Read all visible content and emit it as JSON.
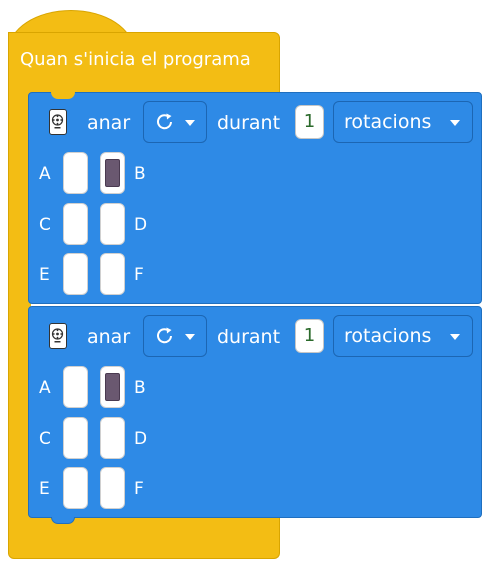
{
  "event_block": {
    "title": "Quan s'inicia el programa",
    "color": "#f3bd14"
  },
  "motor_blocks": [
    {
      "icon": "remote-control-icon",
      "action_label": "anar",
      "direction_icon": "clockwise-rotate-icon",
      "duration_label": "durant",
      "amount": "1",
      "unit": "rotacions",
      "ports": [
        {
          "letter": "A",
          "selected": false
        },
        {
          "letter": "B",
          "selected": true
        },
        {
          "letter": "C",
          "selected": false
        },
        {
          "letter": "D",
          "selected": false
        },
        {
          "letter": "E",
          "selected": false
        },
        {
          "letter": "F",
          "selected": false
        }
      ]
    },
    {
      "icon": "remote-control-icon",
      "action_label": "anar",
      "direction_icon": "clockwise-rotate-icon",
      "duration_label": "durant",
      "amount": "1",
      "unit": "rotacions",
      "ports": [
        {
          "letter": "A",
          "selected": false
        },
        {
          "letter": "B",
          "selected": true
        },
        {
          "letter": "C",
          "selected": false
        },
        {
          "letter": "D",
          "selected": false
        },
        {
          "letter": "E",
          "selected": false
        },
        {
          "letter": "F",
          "selected": false
        }
      ]
    }
  ],
  "colors": {
    "motor_block": "#2e8ae6",
    "selected_port": "#6a5870"
  }
}
